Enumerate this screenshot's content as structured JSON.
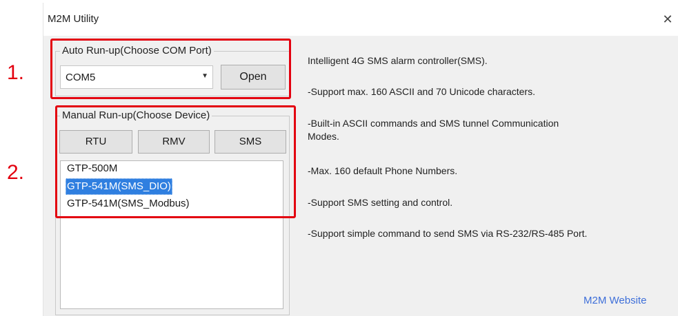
{
  "window": {
    "title": "M2M Utility",
    "close_glyph": "✕"
  },
  "auto_runup": {
    "legend": "Auto Run-up(Choose COM Port)",
    "com_port_value": "COM5",
    "dropdown_glyph": "▼",
    "open_label": "Open"
  },
  "manual_runup": {
    "legend": "Manual Run-up(Choose Device)",
    "buttons": {
      "rtu": "RTU",
      "rmv": "RMV",
      "sms": "SMS"
    },
    "devices": [
      {
        "label": "GTP-500M",
        "selected": false
      },
      {
        "label": "GTP-541M(SMS_DIO)",
        "selected": true
      },
      {
        "label": "GTP-541M(SMS_Modbus)",
        "selected": false
      }
    ]
  },
  "description": {
    "lines": [
      "Intelligent 4G SMS alarm controller(SMS).",
      "-Support max. 160 ASCII and 70 Unicode characters.",
      "-Built-in ASCII commands and SMS tunnel Communication",
      "Modes.",
      "-Max. 160 default Phone Numbers.",
      "-Support SMS setting and control.",
      "-Support simple command to send SMS via RS-232/RS-485 Port."
    ]
  },
  "links": {
    "website": "M2M Website"
  },
  "annotations": {
    "step1": "1.",
    "step2": "2.",
    "color": "#e3000f"
  },
  "colors": {
    "selection": "#2f7fe0",
    "link": "#3e6fd9",
    "window_bg": "#f0f0f0"
  }
}
